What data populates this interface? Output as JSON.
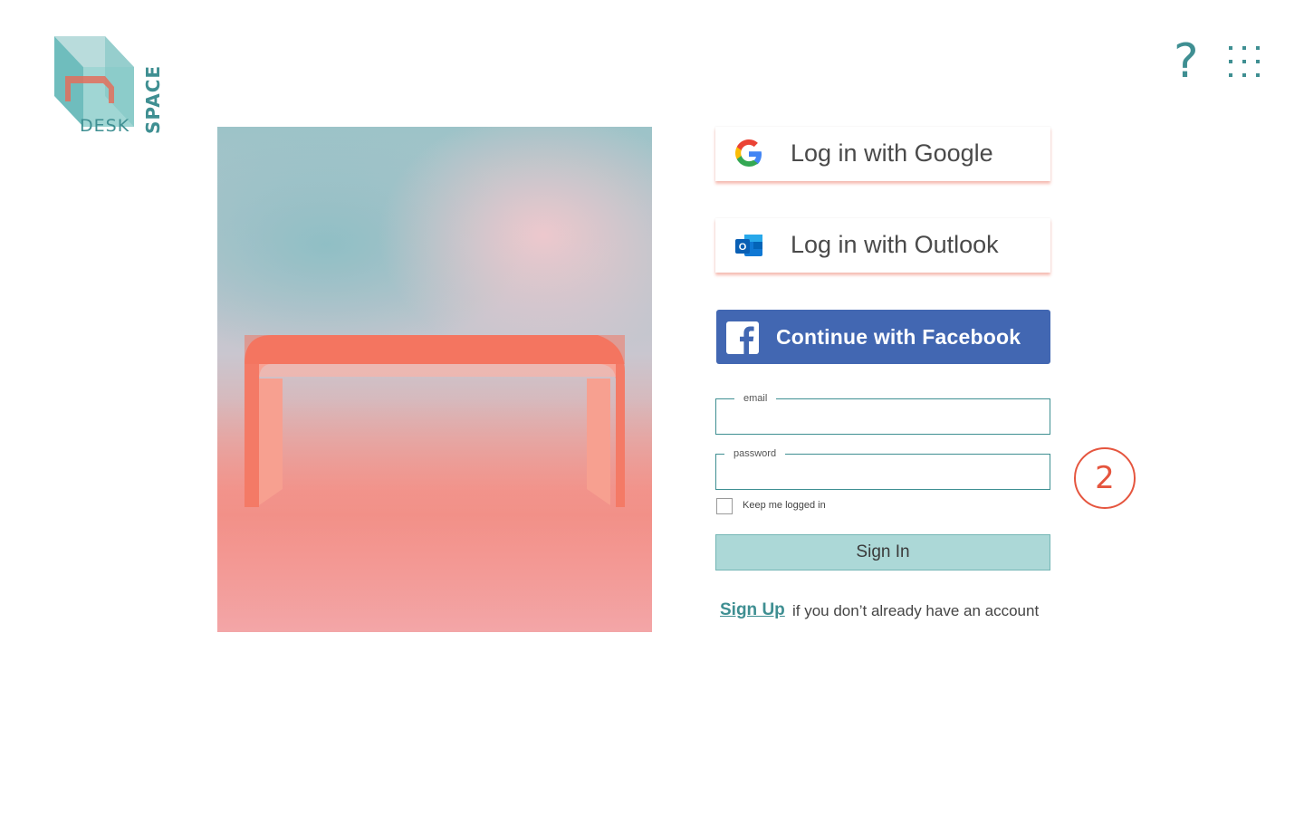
{
  "brand": {
    "word_desk": "DESK",
    "word_space": "SPACE"
  },
  "header": {
    "help_glyph": "?",
    "help_icon": "help-icon",
    "apps_icon": "apps-grid-icon"
  },
  "hero": {
    "subject": "desk",
    "colors": {
      "coral": "#f47a66",
      "teal": "#9cc3c8",
      "pink": "#f0c8cd"
    }
  },
  "login": {
    "google_label": "Log in with Google",
    "outlook_label": "Log in with Outlook",
    "facebook_label": "Continue with Facebook",
    "email_legend": "email",
    "email_value": "",
    "password_legend": "password",
    "password_value": "",
    "remember_label": "Keep me logged in",
    "remember_checked": false,
    "signin_label": "Sign In",
    "signup_link": "Sign Up",
    "signup_text": "if you don’t already have an account"
  },
  "annotation": {
    "step_number": "2",
    "color": "#e5553e"
  },
  "colors": {
    "accent": "#3f8f92",
    "facebook": "#4267b2",
    "signin_bg": "#acd8d7"
  }
}
